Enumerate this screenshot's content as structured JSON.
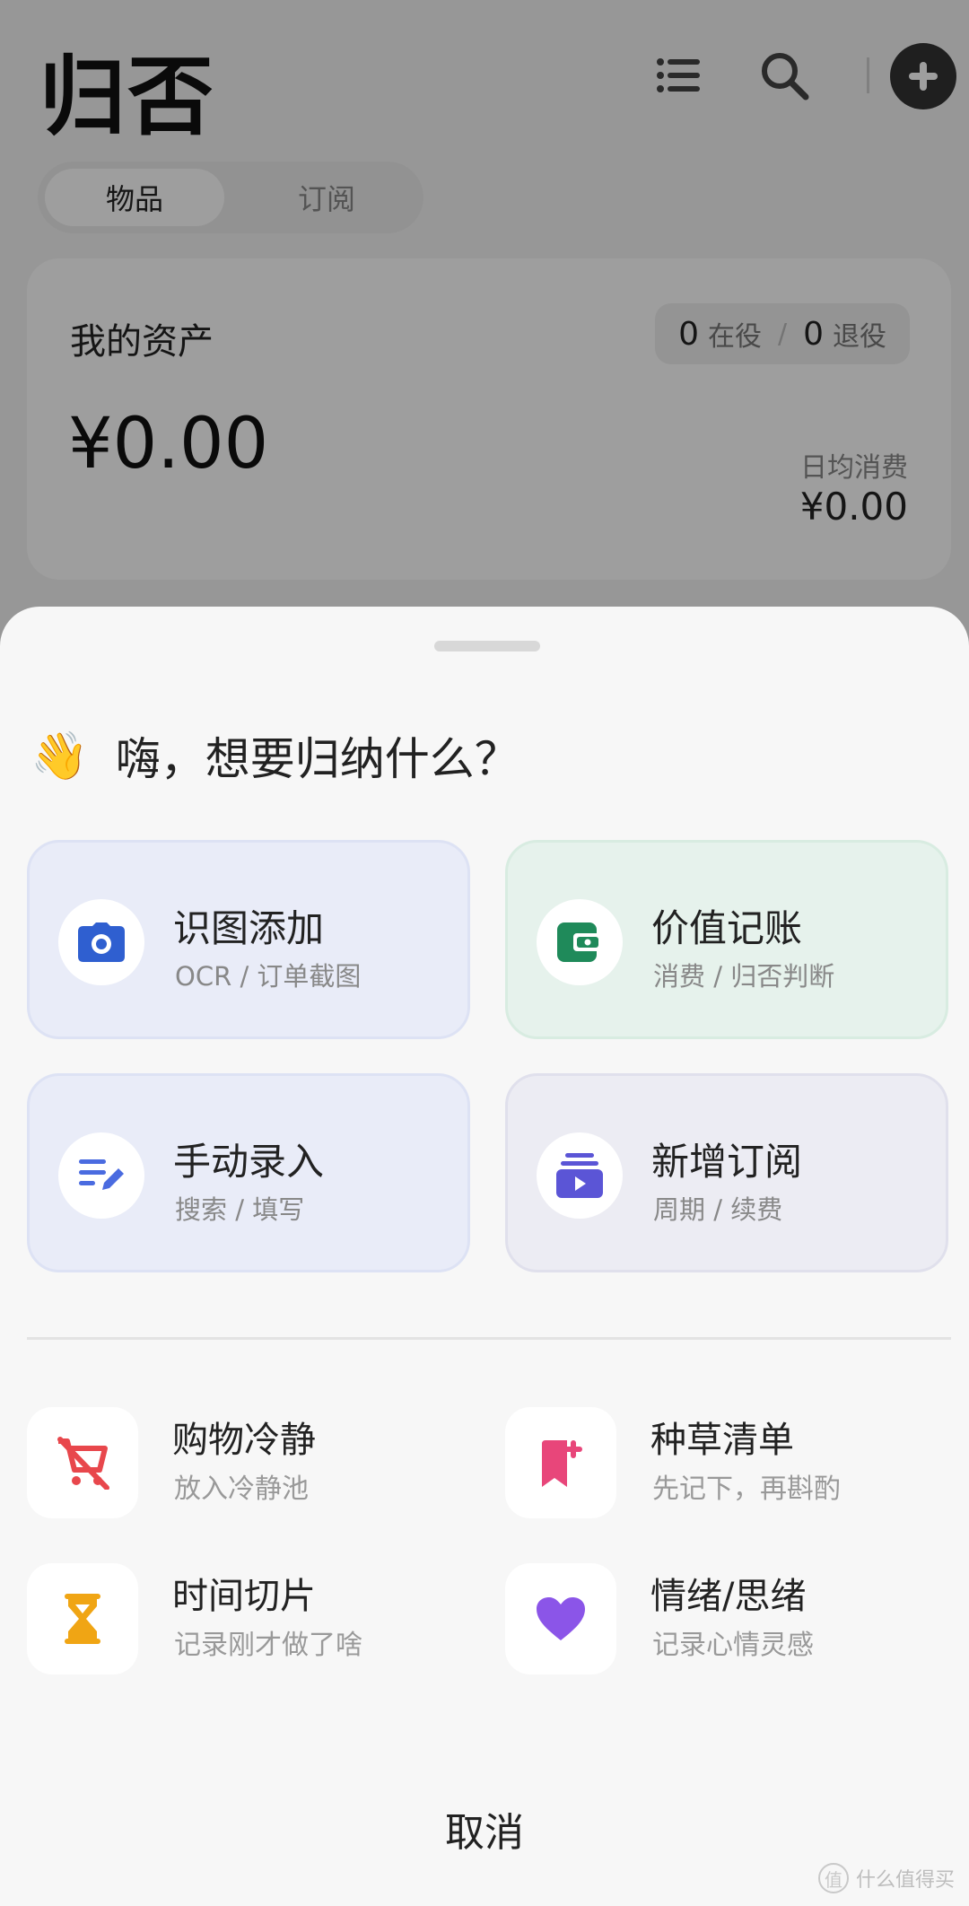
{
  "app": {
    "title": "归否",
    "tabs": [
      {
        "label": "物品",
        "active": true
      },
      {
        "label": "订阅",
        "active": false
      }
    ],
    "icons": {
      "list": "list-icon",
      "search": "search-icon",
      "add": "plus-circle-icon"
    }
  },
  "asset_card": {
    "title": "我的资产",
    "active_count": "0",
    "active_label": "在役",
    "separator": "/",
    "retired_count": "0",
    "retired_label": "退役",
    "amount": "¥0.00",
    "daily_label": "日均消费",
    "daily_value": "¥0.00"
  },
  "sheet": {
    "greeting_emoji": "👋",
    "greeting": "嗨，想要归纳什么？",
    "primary_actions": [
      {
        "title": "识图添加",
        "subtitle": "OCR / 订单截图",
        "icon": "camera-icon",
        "color": "#2f5fd0"
      },
      {
        "title": "价值记账",
        "subtitle": "消费 / 归否判断",
        "icon": "wallet-icon",
        "color": "#1f8a5a"
      },
      {
        "title": "手动录入",
        "subtitle": "搜索 / 填写",
        "icon": "edit-note-icon",
        "color": "#4a6be0"
      },
      {
        "title": "新增订阅",
        "subtitle": "周期 / 续费",
        "icon": "subscription-icon",
        "color": "#5b55d6"
      }
    ],
    "secondary_actions": [
      {
        "title": "购物冷静",
        "subtitle": "放入冷静池",
        "icon": "cart-off-icon",
        "color": "#e8474c"
      },
      {
        "title": "种草清单",
        "subtitle": "先记下，再斟酌",
        "icon": "bookmark-add-icon",
        "color": "#e8467a"
      },
      {
        "title": "时间切片",
        "subtitle": "记录刚才做了啥",
        "icon": "hourglass-icon",
        "color": "#f0a514"
      },
      {
        "title": "情绪/思绪",
        "subtitle": "记录心情灵感",
        "icon": "heart-icon",
        "color": "#8b55e8"
      }
    ],
    "cancel": "取消"
  },
  "watermark": {
    "badge": "值",
    "text": "什么值得买"
  }
}
